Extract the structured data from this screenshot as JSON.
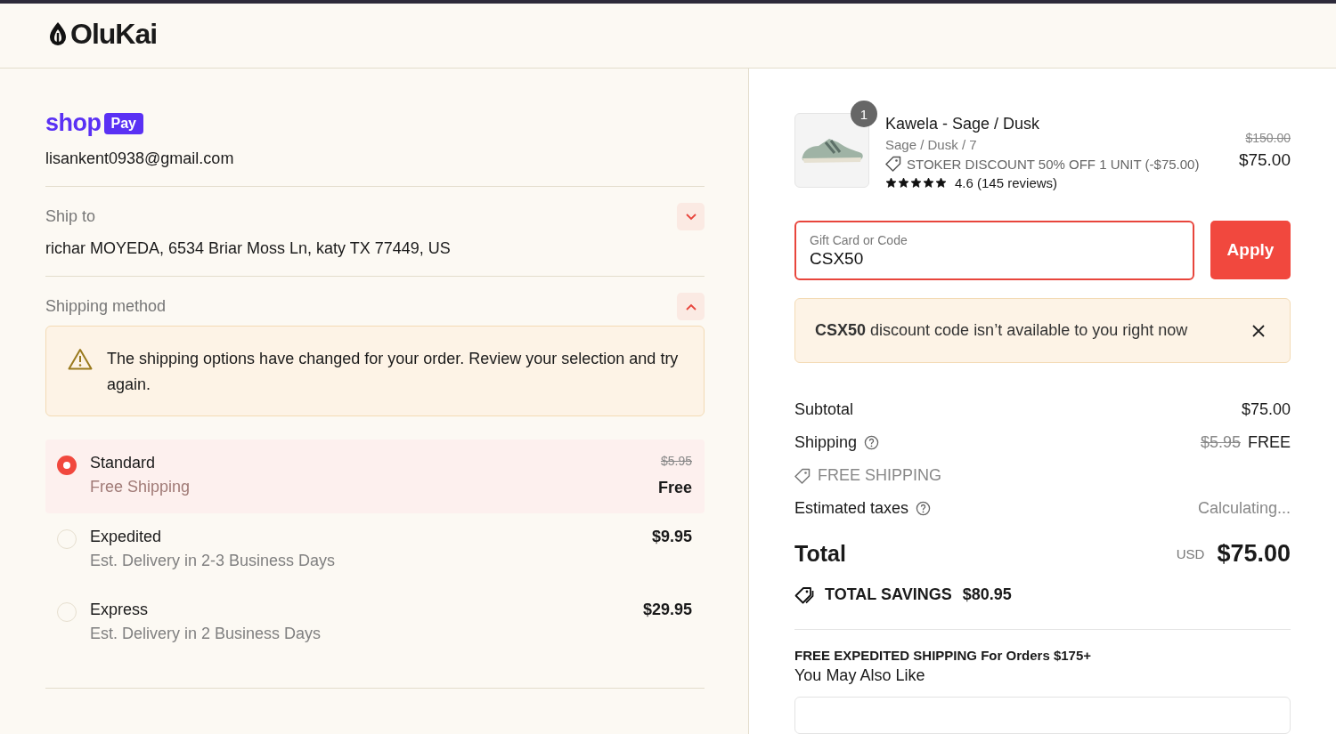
{
  "brand": {
    "name": "OluKai"
  },
  "shop_pay": {
    "word": "shop",
    "badge": "Pay"
  },
  "contact": {
    "email": "lisankent0938@gmail.com"
  },
  "ship_to": {
    "label": "Ship to",
    "expanded": false,
    "address": "richar MOYEDA, 6534 Briar Moss Ln, katy TX 77449, US"
  },
  "shipping_method": {
    "label": "Shipping method",
    "expanded": true,
    "warning": "The shipping options have changed for your order. Review your selection and try again.",
    "options": [
      {
        "name": "Standard",
        "detail": "Free Shipping",
        "old_price": "$5.95",
        "price": "Free",
        "selected": true
      },
      {
        "name": "Expedited",
        "detail": "Est. Delivery in 2-3 Business Days",
        "price": "$9.95",
        "selected": false
      },
      {
        "name": "Express",
        "detail": "Est. Delivery in 2 Business Days",
        "price": "$29.95",
        "selected": false
      }
    ]
  },
  "product": {
    "quantity": "1",
    "name": "Kawela - Sage / Dusk",
    "variant": "Sage / Dusk / 7",
    "discount": "STOKER DISCOUNT 50% OFF 1 UNIT (-$75.00)",
    "stars": 5,
    "rating": "4.6 (145 reviews)",
    "old_price": "$150.00",
    "price": "$75.00"
  },
  "discount_field": {
    "placeholder": "Gift Card or Code",
    "value": "CSX50",
    "error": true
  },
  "apply_button": "Apply",
  "notice": "**CSX50** discount code isn’t available to you right now",
  "summary": {
    "subtotal_label": "Subtotal",
    "subtotal": "$75.00",
    "shipping_label": "Shipping",
    "shipping_old": "$5.95",
    "shipping": "FREE",
    "shipping_discount": "FREE SHIPPING",
    "taxes_label": "Estimated taxes",
    "taxes": "Calculating...",
    "total_label": "Total",
    "currency": "USD",
    "total": "$75.00",
    "savings_label": "TOTAL SAVINGS",
    "savings": "$80.95"
  },
  "promo": {
    "headline": "FREE EXPEDITED SHIPPING For Orders $175+",
    "subtitle": "You May Also Like"
  }
}
